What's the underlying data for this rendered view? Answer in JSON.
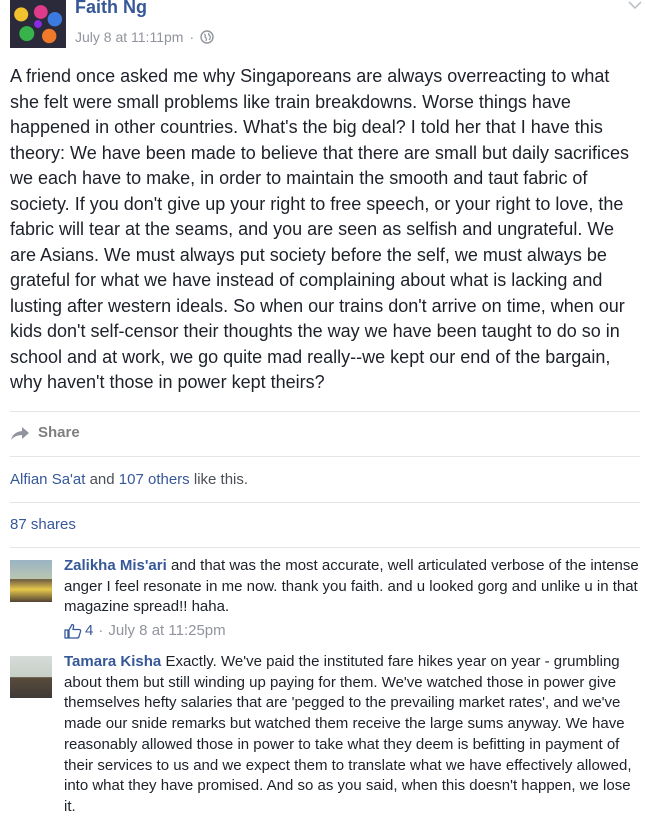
{
  "post": {
    "author": "Faith Ng",
    "time": "July 8 at 11:11pm",
    "separator": "·",
    "text": "A friend once asked me why Singaporeans are always overreacting to what she felt were small problems like train breakdowns. Worse things have happened in other countries. What's the big deal? I told her that I have this theory: We have been made to believe that there are small but daily sacrifices we each have to make, in order to maintain the smooth and taut fabric of society. If you don't give up your right to free speech, or your right to love, the fabric will tear at the seams, and you are seen as selfish and ungrateful. We are Asians. We must always put society before the self, we must always be grateful for what we have instead of complaining about what is lacking and lusting after western ideals. So when our trains don't arrive on time, when our kids don't self-censor their thoughts the way we have been taught to do so in school and at work, we go quite mad really--we kept our end of the bargain, why haven't those in power kept theirs?",
    "icons": {
      "privacy": "globe-icon",
      "options": "chevron-down-icon"
    }
  },
  "actions": {
    "share_label": "Share",
    "share_icon": "share-arrow-icon"
  },
  "likes": {
    "first_name": "Alfian Sa'at",
    "and": "and",
    "others": "107 others",
    "suffix": "like this."
  },
  "shares": {
    "label": "87 shares"
  },
  "comments": [
    {
      "author": "Zalikha Mis'ari",
      "text": "and that was the most accurate, well articulated verbose of the intense anger I feel resonate in me now. thank you faith. and u looked gorg and unlike u in that magazine spread!! haha.",
      "likes": "4",
      "separator": "·",
      "time": "July 8 at 11:25pm"
    },
    {
      "author": "Tamara Kisha",
      "text": "Exactly. We've paid the instituted fare hikes year on year - grumbling about them but still winding up paying for them. We've watched those in power give themselves hefty salaries that are 'pegged to the prevailing market rates', and we've made our snide remarks but watched them receive the large sums anyway. We have reasonably allowed those in power to take what they deem is befitting in payment of their services to us and we expect them to translate what we have effectively allowed, into what they have promised. And so as you said, when this doesn't happen, we lose it."
    }
  ],
  "colors": {
    "link": "#365899",
    "text": "#1d2129",
    "meta": "#90949c",
    "divider": "#e5e5e5"
  }
}
